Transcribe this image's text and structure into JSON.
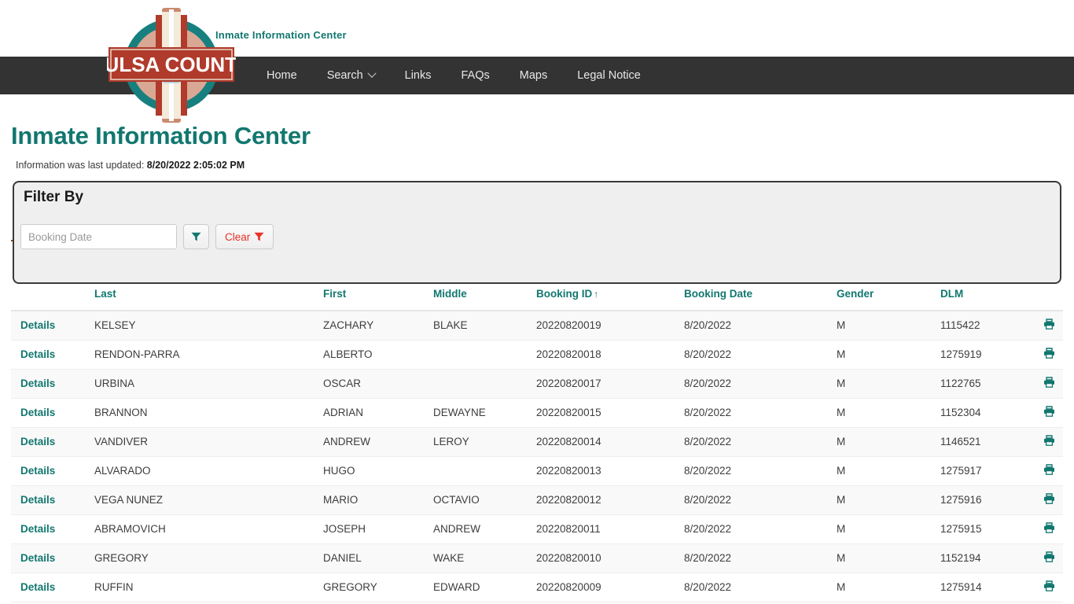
{
  "header": {
    "site_name": "Inmate Information Center",
    "logo_text": "TULSA COUNTY",
    "nav": [
      {
        "label": "Home",
        "icon": ""
      },
      {
        "label": "Search",
        "icon": "chevron-down-icon"
      },
      {
        "label": "Links",
        "icon": ""
      },
      {
        "label": "FAQs",
        "icon": ""
      },
      {
        "label": "Maps",
        "icon": ""
      },
      {
        "label": "Legal Notice",
        "icon": ""
      }
    ]
  },
  "page": {
    "title": "Inmate Information Center",
    "updated_label": "Information was last updated:",
    "updated_value": "8/20/2022 2:05:02 PM"
  },
  "filter": {
    "legend": "Filter By",
    "booking_date_placeholder": "Booking Date",
    "booking_date_value": "",
    "apply_label": "",
    "clear_label": "Clear"
  },
  "table": {
    "columns": [
      {
        "key": "details",
        "label": ""
      },
      {
        "key": "last",
        "label": "Last"
      },
      {
        "key": "first",
        "label": "First"
      },
      {
        "key": "middle",
        "label": "Middle"
      },
      {
        "key": "booking_id",
        "label": "Booking ID",
        "sort": "↑"
      },
      {
        "key": "booking_date",
        "label": "Booking Date"
      },
      {
        "key": "gender",
        "label": "Gender"
      },
      {
        "key": "dlm",
        "label": "DLM"
      },
      {
        "key": "print",
        "label": ""
      }
    ],
    "details_label": "Details",
    "rows": [
      {
        "details": "Details",
        "last": "KELSEY",
        "first": "ZACHARY",
        "middle": "BLAKE",
        "booking_id": "20220820019",
        "booking_date": "8/20/2022",
        "gender": "M",
        "dlm": "1115422"
      },
      {
        "details": "Details",
        "last": "RENDON-PARRA",
        "first": "ALBERTO",
        "middle": "",
        "booking_id": "20220820018",
        "booking_date": "8/20/2022",
        "gender": "M",
        "dlm": "1275919"
      },
      {
        "details": "Details",
        "last": "URBINA",
        "first": "OSCAR",
        "middle": "",
        "booking_id": "20220820017",
        "booking_date": "8/20/2022",
        "gender": "M",
        "dlm": "1122765"
      },
      {
        "details": "Details",
        "last": "BRANNON",
        "first": "ADRIAN",
        "middle": "DEWAYNE",
        "booking_id": "20220820015",
        "booking_date": "8/20/2022",
        "gender": "M",
        "dlm": "1152304"
      },
      {
        "details": "Details",
        "last": "VANDIVER",
        "first": "ANDREW",
        "middle": "LEROY",
        "booking_id": "20220820014",
        "booking_date": "8/20/2022",
        "gender": "M",
        "dlm": "1146521"
      },
      {
        "details": "Details",
        "last": "ALVARADO",
        "first": "HUGO",
        "middle": "",
        "booking_id": "20220820013",
        "booking_date": "8/20/2022",
        "gender": "M",
        "dlm": "1275917"
      },
      {
        "details": "Details",
        "last": "VEGA NUNEZ",
        "first": "MARIO",
        "middle": "OCTAVIO",
        "booking_id": "20220820012",
        "booking_date": "8/20/2022",
        "gender": "M",
        "dlm": "1275916"
      },
      {
        "details": "Details",
        "last": "ABRAMOVICH",
        "first": "JOSEPH",
        "middle": "ANDREW",
        "booking_id": "20220820011",
        "booking_date": "8/20/2022",
        "gender": "M",
        "dlm": "1275915"
      },
      {
        "details": "Details",
        "last": "GREGORY",
        "first": "DANIEL",
        "middle": "WAKE",
        "booking_id": "20220820010",
        "booking_date": "8/20/2022",
        "gender": "M",
        "dlm": "1152194"
      },
      {
        "details": "Details",
        "last": "RUFFIN",
        "first": "GREGORY",
        "middle": "EDWARD",
        "booking_id": "20220820009",
        "booking_date": "8/20/2022",
        "gender": "M",
        "dlm": "1275914"
      }
    ]
  },
  "icons": {
    "print": "print-icon",
    "filter": "funnel-icon",
    "clear": "funnel-icon"
  },
  "colors": {
    "teal": "#11776f",
    "navbar": "#333333",
    "rule_brown": "#8a4b21",
    "clear_red": "#e8322a",
    "logo_red": "#b03a2b",
    "logo_teal": "#1c8a8a"
  }
}
